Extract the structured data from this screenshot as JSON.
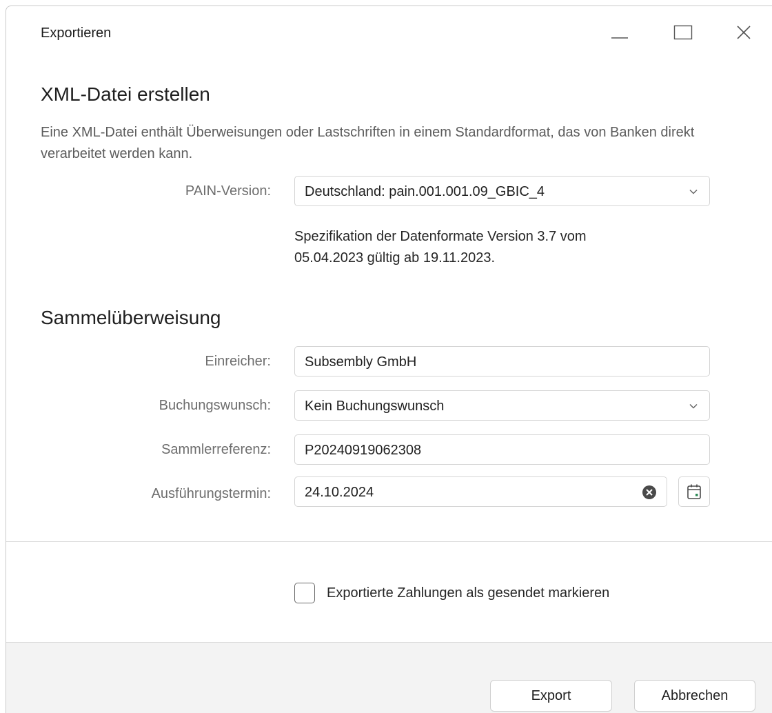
{
  "window": {
    "title": "Exportieren"
  },
  "xml": {
    "heading": "XML-Datei erstellen",
    "description": "Eine XML-Datei enthält Überweisungen oder Lastschriften in einem Standardformat, das von Banken direkt verarbeitet werden kann.",
    "pain_label": "PAIN-Version:",
    "pain_value": "Deutschland: pain.001.001.09_GBIC_4",
    "spec_line1": "Spezifikation der Datenformate Version 3.7 vom",
    "spec_line2": "05.04.2023 gültig ab 19.11.2023."
  },
  "sammel": {
    "heading": "Sammelüberweisung",
    "einreicher_label": "Einreicher:",
    "einreicher_value": "Subsembly GmbH",
    "buchung_label": "Buchungswunsch:",
    "buchung_value": "Kein Buchungswunsch",
    "referenz_label": "Sammlerreferenz:",
    "referenz_value": "P20240919062308",
    "termin_label": "Ausführungstermin:",
    "termin_value": "24.10.2024"
  },
  "options": {
    "mark_sent_label": "Exportierte Zahlungen als gesendet markieren",
    "mark_sent_checked": false
  },
  "footer": {
    "export_label": "Export",
    "cancel_label": "Abbrechen"
  },
  "icons": {
    "minimize": "minimize-icon",
    "maximize": "maximize-icon",
    "close": "close-icon",
    "dropdown": "chevron-down-icon",
    "clear": "clear-circle-icon",
    "calendar": "calendar-icon"
  },
  "colors": {
    "accent_green": "#2e8b57",
    "footer_bg": "#f3f3f3"
  }
}
